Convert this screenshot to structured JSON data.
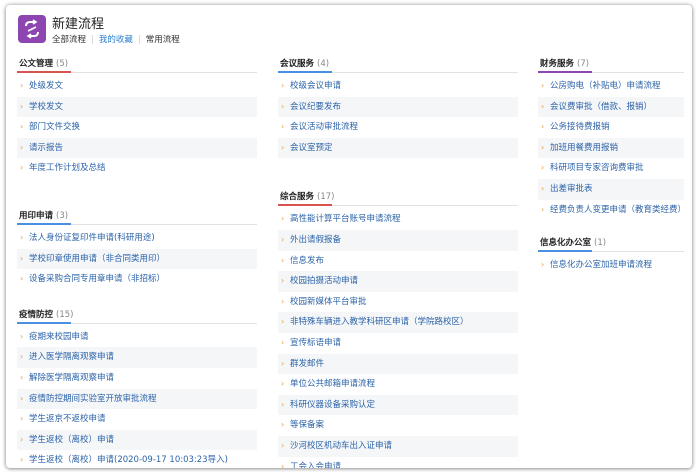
{
  "header": {
    "title": "新建流程",
    "tabs": [
      {
        "label": "全部流程",
        "active": false
      },
      {
        "label": "我的收藏",
        "active": true
      },
      {
        "label": "常用流程",
        "active": false
      }
    ],
    "accent_color": "#8d46b0"
  },
  "sections": {
    "gongwen": {
      "title": "公文管理",
      "count": "(5)",
      "items": [
        "处级发文",
        "学校发文",
        "部门文件交换",
        "请示报告",
        "年度工作计划及总结"
      ]
    },
    "yongyin": {
      "title": "用印申请",
      "count": "(3)",
      "items": [
        "法人身份证复印件申请(科研用途)",
        "学校印章使用申请（非合同类用印）",
        "设备采购合同专用章申请（非招标）"
      ]
    },
    "yiqing": {
      "title": "疫情防控",
      "count": "(15)",
      "items": [
        "疫期来校园申请",
        "进入医学隔离观察申请",
        "解除医学隔离观察申请",
        "疫情防控期间实验室开放审批流程",
        "学生返京不返校申请",
        "学生返校（离校）申请",
        "学生返校（离校）申请(2020-09-17 10:03:23导入)"
      ]
    },
    "huiyi": {
      "title": "会议服务",
      "count": "(4)",
      "items": [
        "校级会议申请",
        "会议纪要发布",
        "会议活动审批流程",
        "会议室预定"
      ]
    },
    "zonghe": {
      "title": "综合服务",
      "count": "(17)",
      "items": [
        "高性能计算平台账号申请流程",
        "外出请假报备",
        "信息发布",
        "校园拍摄活动申请",
        "校园新媒体平台审批",
        "非特殊车辆进入教学科研区申请（学院路校区）",
        "宣传标语申请",
        "群发邮件",
        "单位公共邮箱申请流程",
        "科研仪器设备采购认定",
        "等保备案",
        "沙河校区机动车出入证申请",
        "工会入会申请"
      ]
    },
    "caiwu": {
      "title": "财务服务",
      "count": "(7)",
      "items": [
        "公房购电（补贴电）申请流程",
        "会议费审批（借款、报销）",
        "公务接待费报销",
        "加班用餐费用报销",
        "科研项目专家咨询费审批",
        "出差审批表",
        "经费负责人变更申请（教育类经费）"
      ]
    },
    "xinxihua": {
      "title": "信息化办公室",
      "count": "(1)",
      "items": [
        "信息化办公室加班申请流程"
      ]
    }
  },
  "bullet_glyph": "›"
}
